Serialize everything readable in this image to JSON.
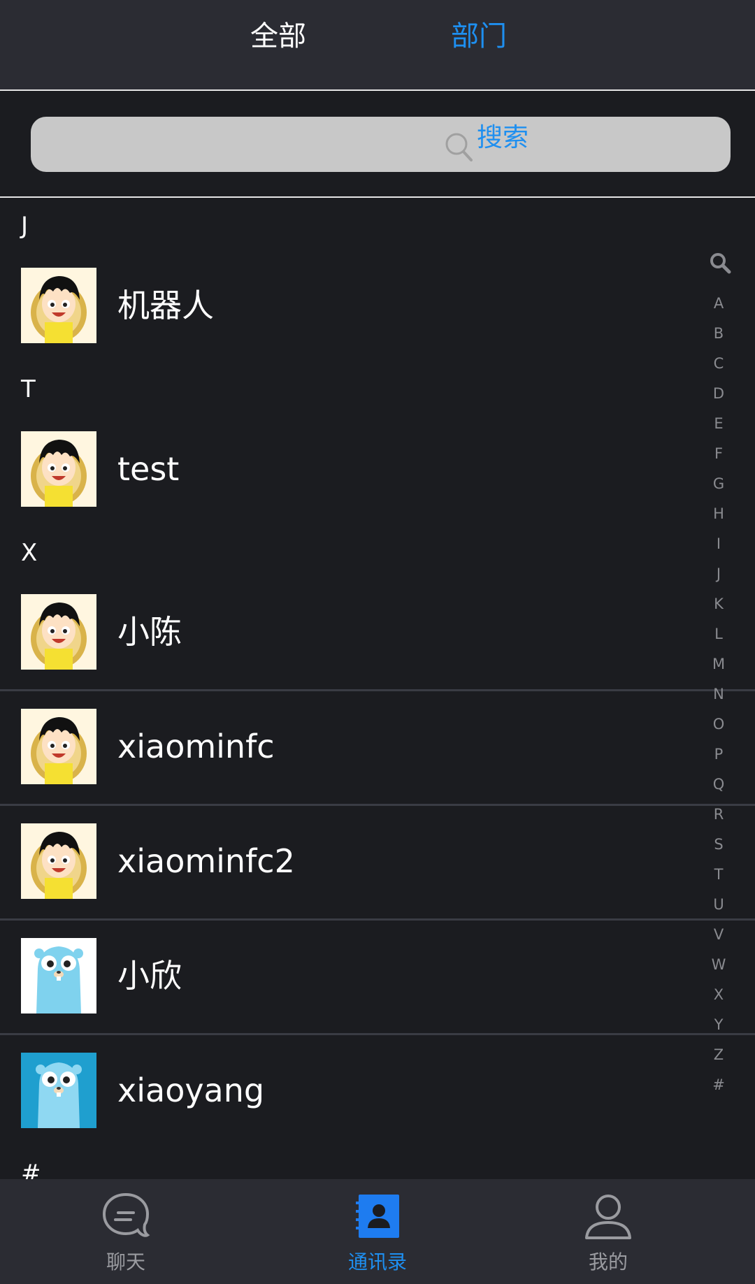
{
  "header": {
    "tabs": [
      {
        "label": "全部",
        "active": false
      },
      {
        "label": "部门",
        "active": true
      }
    ],
    "active_color": "#1e8ff0"
  },
  "search": {
    "placeholder": "搜索"
  },
  "contacts": {
    "sections": [
      {
        "letter": "J",
        "items": [
          {
            "name": "机器人",
            "avatar": "luffy-avatar"
          }
        ]
      },
      {
        "letter": "T",
        "items": [
          {
            "name": "test",
            "avatar": "luffy-avatar"
          }
        ]
      },
      {
        "letter": "X",
        "items": [
          {
            "name": "小陈",
            "avatar": "luffy-avatar"
          },
          {
            "name": "xiaominfc",
            "avatar": "luffy-avatar"
          },
          {
            "name": "xiaominfc2",
            "avatar": "luffy-avatar"
          },
          {
            "name": "小欣",
            "avatar": "gopher-avatar"
          },
          {
            "name": "xiaoyang",
            "avatar": "gopher-avatar-blue-bg"
          }
        ]
      },
      {
        "letter": "#",
        "items": []
      }
    ]
  },
  "index_bar": {
    "search_icon": "search-icon",
    "letters": [
      "A",
      "B",
      "C",
      "D",
      "E",
      "F",
      "G",
      "H",
      "I",
      "J",
      "K",
      "L",
      "M",
      "N",
      "O",
      "P",
      "Q",
      "R",
      "S",
      "T",
      "U",
      "V",
      "W",
      "X",
      "Y",
      "Z",
      "#"
    ]
  },
  "tab_bar": {
    "items": [
      {
        "label": "聊天",
        "icon": "chat-bubble-icon",
        "active": false
      },
      {
        "label": "通讯录",
        "icon": "contacts-book-icon",
        "active": true
      },
      {
        "label": "我的",
        "icon": "person-icon",
        "active": false
      }
    ]
  }
}
